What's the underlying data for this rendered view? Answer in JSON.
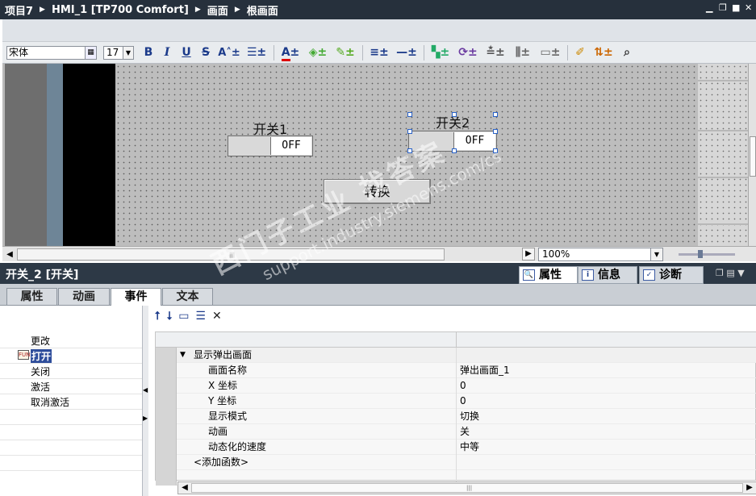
{
  "titlebar": {
    "crumbs": [
      "项目7",
      "HMI_1 [TP700 Comfort]",
      "画面",
      "根画面"
    ],
    "separator": "▶"
  },
  "toolbar": {
    "font_name": "宋体",
    "font_size": "17",
    "bold": "B",
    "italic": "I",
    "underline": "U",
    "strike": "S"
  },
  "canvas": {
    "switch1": {
      "label": "开关1",
      "state": "OFF"
    },
    "switch2": {
      "label": "开关2",
      "state": "OFF"
    },
    "convert_button": "转换",
    "zoom": "100%"
  },
  "properties": {
    "title": "开关_2 [开关]",
    "tabs": [
      "属性",
      "信息",
      "诊断"
    ],
    "active_tab": "属性",
    "subtabs": [
      "属性",
      "动画",
      "事件",
      "文本"
    ],
    "active_subtab": "事件"
  },
  "events": {
    "items": [
      "更改",
      "打开",
      "关闭",
      "激活",
      "取消激活"
    ],
    "selected": "打开"
  },
  "function_list": {
    "group": "显示弹出画面",
    "rows": [
      {
        "name": "画面名称",
        "value": "弹出画面_1"
      },
      {
        "name": "X 坐标",
        "value": "0"
      },
      {
        "name": "Y 坐标",
        "value": "0"
      },
      {
        "name": "显示模式",
        "value": "切换"
      },
      {
        "name": "动画",
        "value": "关"
      },
      {
        "name": "动态化的速度",
        "value": "中等"
      }
    ],
    "add_function": "<添加函数>"
  },
  "watermark": {
    "line1": "西门子工业 找答案",
    "line2": "support.industry.siemens.com/cs"
  },
  "icons": {
    "move_up": "arrow-up-icon",
    "move_down": "arrow-down-icon",
    "insert": "folder-icon",
    "list": "list-icon",
    "delete": "x-icon"
  }
}
